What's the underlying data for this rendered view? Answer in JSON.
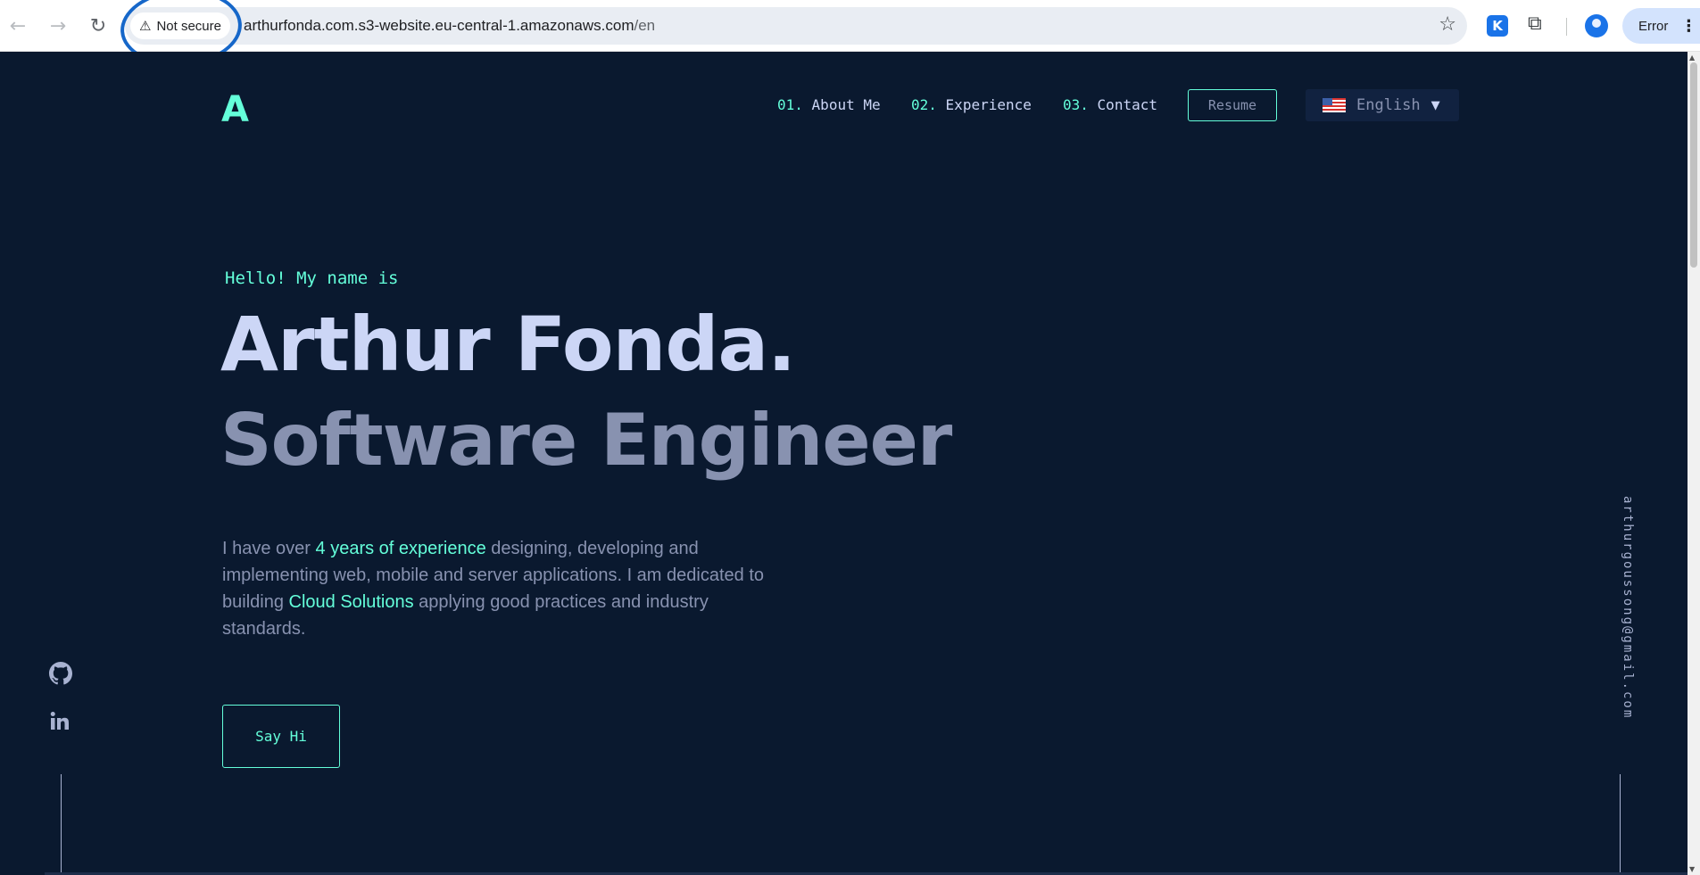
{
  "browser": {
    "security_label": "Not secure",
    "url_domain": "arthurfonda.com.s3-website.eu-central-1.amazonaws.com",
    "url_path": "/en",
    "profile_status": "Error",
    "icons": [
      "back-arrow-icon",
      "forward-arrow-icon",
      "reload-icon",
      "warning-icon",
      "star-icon",
      "extension-k-icon",
      "puzzle-icon",
      "profile-icon",
      "more-vert-icon"
    ],
    "annotation_color": "#1667c9"
  },
  "site": {
    "logo": "A",
    "nav": [
      {
        "num": "01.",
        "label": "About Me"
      },
      {
        "num": "02.",
        "label": "Experience"
      },
      {
        "num": "03.",
        "label": "Contact"
      }
    ],
    "resume_label": "Resume",
    "language": "English",
    "hero": {
      "greeting": "Hello! My name is",
      "name": "Arthur Fonda.",
      "role": "Software Engineer",
      "intro_1": "I have over ",
      "intro_hl_1": "4 years of experience",
      "intro_2": " designing, developing and implementing web, mobile and server applications. I am dedicated to building ",
      "intro_hl_2": "Cloud Solutions",
      "intro_3": " applying good practices and industry standards.",
      "cta": "Say Hi"
    },
    "email": "arthurgoussong@gmail.com",
    "social": [
      "github-icon",
      "linkedin-icon"
    ],
    "colors": {
      "background": "#0a192f",
      "accent": "#64ffda",
      "heading": "#ccd6f6",
      "muted": "#8892b0"
    }
  }
}
